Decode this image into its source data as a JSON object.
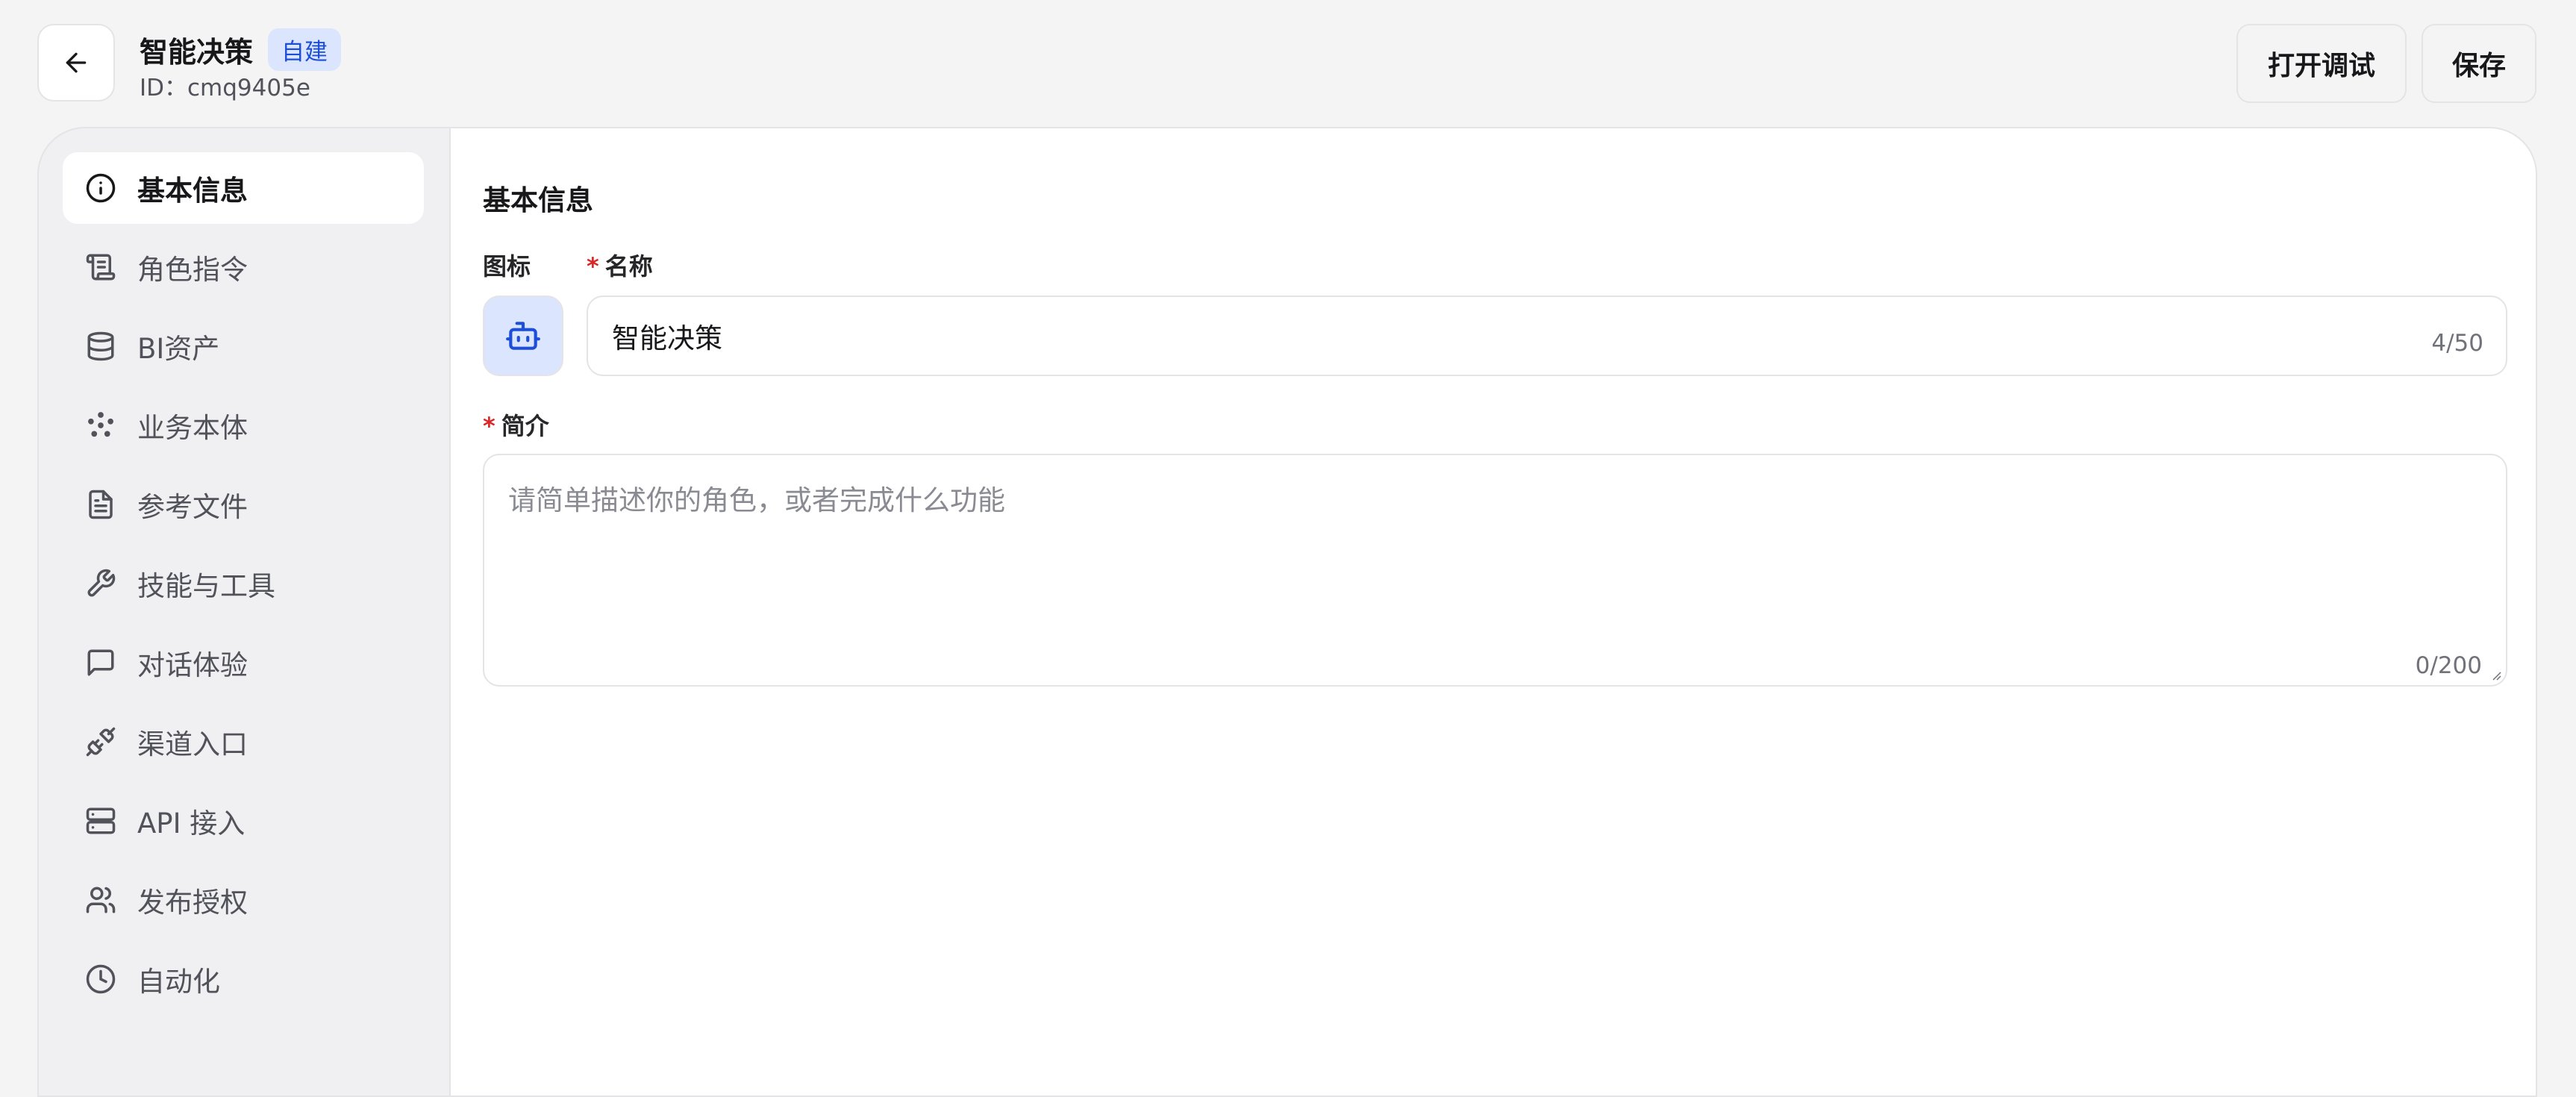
{
  "header": {
    "title": "智能决策",
    "badge": "自建",
    "id_text": "ID：cmq9405e",
    "debug_label": "打开调试",
    "save_label": "保存"
  },
  "sidebar": {
    "items": [
      {
        "label": "基本信息",
        "icon": "info-icon",
        "active": true
      },
      {
        "label": "角色指令",
        "icon": "scroll-icon"
      },
      {
        "label": "BI资产",
        "icon": "database-icon"
      },
      {
        "label": "业务本体",
        "icon": "network-icon"
      },
      {
        "label": "参考文件",
        "icon": "document-icon"
      },
      {
        "label": "技能与工具",
        "icon": "wrench-icon"
      },
      {
        "label": "对话体验",
        "icon": "chat-icon"
      },
      {
        "label": "渠道入口",
        "icon": "plug-icon"
      },
      {
        "label": "API 接入",
        "icon": "server-icon"
      },
      {
        "label": "发布授权",
        "icon": "users-icon"
      },
      {
        "label": "自动化",
        "icon": "clock-icon"
      }
    ]
  },
  "main": {
    "section_title": "基本信息",
    "icon_label": "图标",
    "name_label": "名称",
    "name_value": "智能决策",
    "name_counter": "4/50",
    "intro_label": "简介",
    "intro_placeholder": "请简单描述你的角色，或者完成什么功能",
    "intro_counter": "0/200",
    "required_mark": "*"
  },
  "colors": {
    "accent": "#1d4ed8",
    "badge_bg": "#dbe6fe",
    "required": "#dc2626"
  }
}
